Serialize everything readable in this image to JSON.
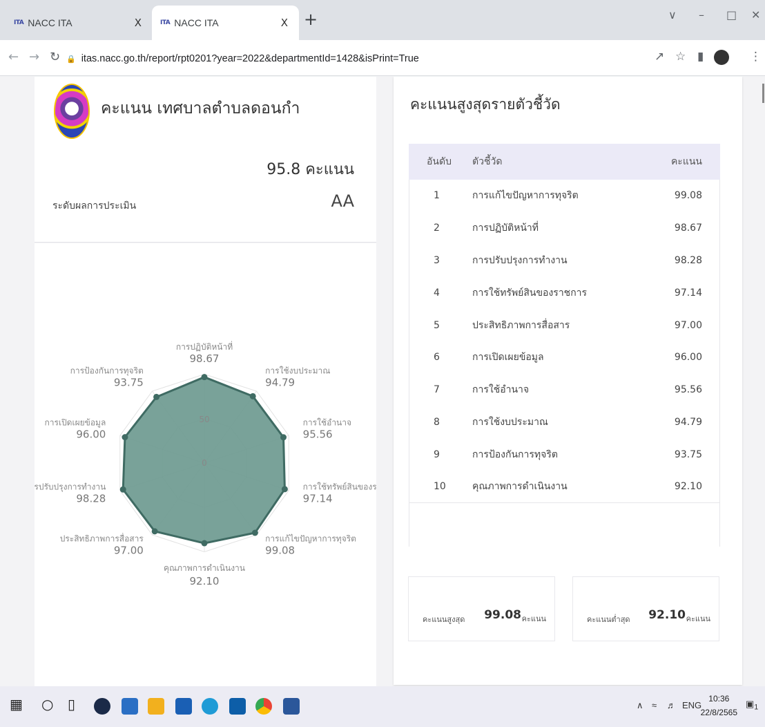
{
  "browser": {
    "tabs": [
      {
        "favicon": "ITA",
        "title": "NACC ITA",
        "close": "X"
      },
      {
        "favicon": "ITA",
        "title": "NACC ITA",
        "close": "X"
      }
    ],
    "new_tab": "+",
    "url": "itas.nacc.go.th/report/rpt0201?year=2022&departmentId=1428&isPrint=True"
  },
  "summary": {
    "title": "คะแนน เทศบาลตำบลดอนกำ",
    "score_text": "95.8 คะแนน",
    "level_label": "ระดับผลการประเมิน",
    "level": "AA"
  },
  "radar": {
    "scale_labels": [
      "50",
      "0"
    ],
    "items": [
      {
        "label": "การปฏิบัติหน้าที่",
        "value": "98.67"
      },
      {
        "label": "การใช้งบประมาณ",
        "value": "94.79"
      },
      {
        "label": "การใช้อำนาจ",
        "value": "95.56"
      },
      {
        "label": "การใช้ทรัพย์สินของราชก",
        "value": "97.14"
      },
      {
        "label": "การแก้ไขปัญหาการทุจริต",
        "value": "99.08"
      },
      {
        "label": "คุณภาพการดำเนินงาน",
        "value": "92.10"
      },
      {
        "label": "ประสิทธิภาพการสื่อสาร",
        "value": "97.00"
      },
      {
        "label": "การปรับปรุงการทำงาน",
        "value": "98.28"
      },
      {
        "label": "การเปิดเผยข้อมูล",
        "value": "96.00"
      },
      {
        "label": "การป้องกันการทุจริต",
        "value": "93.75"
      }
    ]
  },
  "chart_data": {
    "type": "radar",
    "categories": [
      "การปฏิบัติหน้าที่",
      "การใช้งบประมาณ",
      "การใช้อำนาจ",
      "การใช้ทรัพย์สินของราชก",
      "การแก้ไขปัญหาการทุจริต",
      "คุณภาพการดำเนินงาน",
      "ประสิทธิภาพการสื่อสาร",
      "การปรับปรุงการทำงาน",
      "การเปิดเผยข้อมูล",
      "การป้องกันการทุจริต"
    ],
    "values": [
      98.67,
      94.79,
      95.56,
      97.14,
      99.08,
      92.1,
      97.0,
      98.28,
      96.0,
      93.75
    ],
    "ylim": [
      0,
      100
    ],
    "fill_color": "#6e9a90",
    "line_color": "#3f6b63"
  },
  "ranking": {
    "title": "คะแนนสูงสุดรายตัวชี้วัด",
    "headers": {
      "rank": "อันดับ",
      "name": "ตัวชี้วัด",
      "score": "คะแนน"
    },
    "rows": [
      {
        "rank": "1",
        "name": "การแก้ไขปัญหาการทุจริต",
        "score": "99.08"
      },
      {
        "rank": "2",
        "name": "การปฏิบัติหน้าที่",
        "score": "98.67"
      },
      {
        "rank": "3",
        "name": "การปรับปรุงการทำงาน",
        "score": "98.28"
      },
      {
        "rank": "4",
        "name": "การใช้ทรัพย์สินของราชการ",
        "score": "97.14"
      },
      {
        "rank": "5",
        "name": "ประสิทธิภาพการสื่อสาร",
        "score": "97.00"
      },
      {
        "rank": "6",
        "name": "การเปิดเผยข้อมูล",
        "score": "96.00"
      },
      {
        "rank": "7",
        "name": "การใช้อำนาจ",
        "score": "95.56"
      },
      {
        "rank": "8",
        "name": "การใช้งบประมาณ",
        "score": "94.79"
      },
      {
        "rank": "9",
        "name": "การป้องกันการทุจริต",
        "score": "93.75"
      },
      {
        "rank": "10",
        "name": "คุณภาพการดำเนินงาน",
        "score": "92.10"
      }
    ]
  },
  "stats": {
    "max_label": "คะแนนสูงสุด",
    "max_value": "99.08",
    "min_label": "คะแนนต่ำสุด",
    "min_value": "92.10",
    "unit": "คะแนน"
  },
  "taskbar": {
    "lang": "ENG",
    "time": "10:36",
    "date": "22/8/2565",
    "notification_count": "1"
  },
  "colors": {
    "header_row": "#ebeaf7",
    "radar_fill": "#6e9a90",
    "radar_line": "#3f6b63"
  }
}
